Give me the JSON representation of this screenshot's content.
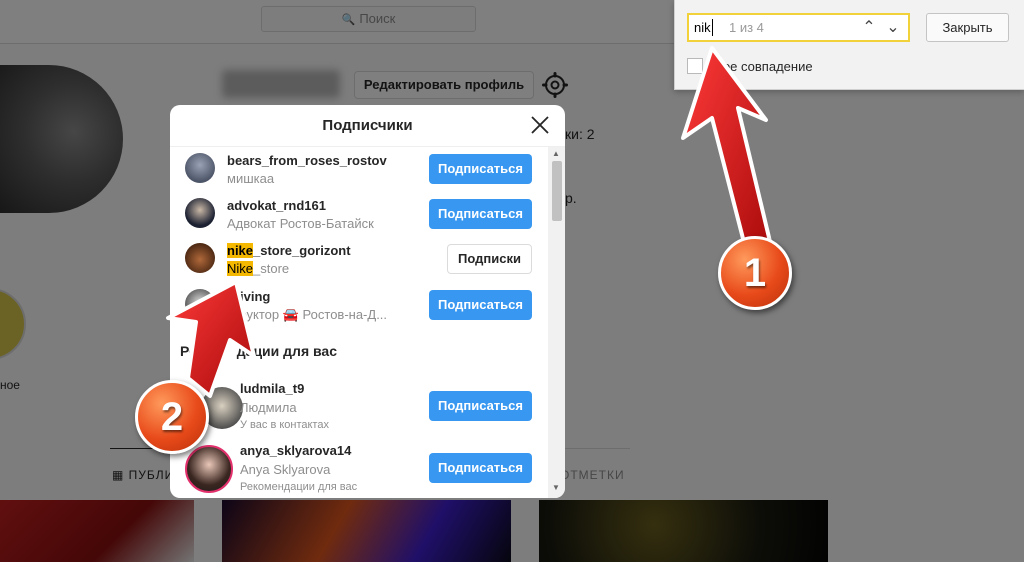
{
  "topbar": {
    "search_placeholder": "Поиск"
  },
  "profile": {
    "edit_button": "Редактировать профиль",
    "stat_fragment": "ки: 2",
    "bio_fragment": "р.",
    "highlight_label": "ное",
    "tab_publications": "ПУБЛИ",
    "tab_marks": "ОТМЕТКИ"
  },
  "findbar": {
    "query": "nik",
    "count": "1 из 4",
    "close_button": "Закрыть",
    "exact_match_label": "чное совпадение"
  },
  "modal": {
    "title": "Подписчики",
    "followers": [
      {
        "username": "bears_from_roses_rostov",
        "subtitle": "мишкаа",
        "button": "Подписаться"
      },
      {
        "username": "advokat_rnd161",
        "subtitle": "Адвокат Ростов-Батайск",
        "button": "Подписаться"
      },
      {
        "username_match": "nike",
        "username_rest": "_store_gorizont",
        "subtitle_match": "Nike",
        "subtitle_rest": "_store",
        "button": "Подписки"
      },
      {
        "username": "driving",
        "subtitle": "структор 🚘 Ростов-на-Д...",
        "button": "Подписаться"
      }
    ],
    "section_title_part1": "Ре",
    "section_title_part2": "дации для вас",
    "recommendations": [
      {
        "username": "ludmila_t9",
        "subtitle": "Людмила",
        "hint": "У вас в контактах",
        "button": "Подписаться"
      },
      {
        "username": "anya_sklyarova14",
        "subtitle": "Anya Sklyarova",
        "hint": "Рекомендации для вас",
        "button": "Подписаться"
      }
    ]
  },
  "annotations": {
    "badge1": "1",
    "badge2": "2"
  },
  "colors": {
    "accent": "#3897f0",
    "highlight": "#f5b800",
    "arrow": "#d31414",
    "find_border": "#f2d23a"
  }
}
